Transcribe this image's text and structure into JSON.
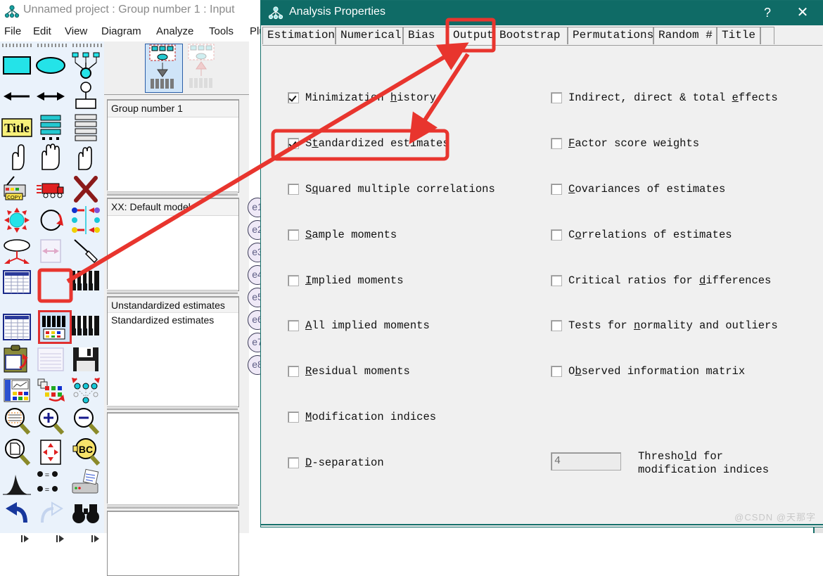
{
  "app": {
    "title": "Unnamed project : Group number 1 : Input",
    "icon": "amos-logo-icon",
    "menu": [
      "File",
      "Edit",
      "View",
      "Diagram",
      "Analyze",
      "Tools",
      "Plu"
    ]
  },
  "palette": {
    "name": "drawing-tools-palette",
    "selected_tool": "view-text-output-tool",
    "tools": [
      "draw-observed-variable",
      "draw-unobserved-variable",
      "draw-path-latent",
      "draw-path-arrow",
      "draw-covariance-arrow",
      "add-unique-variable",
      "figure-caption-title",
      "list-variables-in-dataset",
      "list-variables-in-model",
      "select-one-object",
      "select-all-objects",
      "deselect-all-objects",
      "duplicate-objects",
      "move-objects",
      "erase-objects",
      "shape-of-object",
      "rotate-indicators",
      "reflect-indicators",
      "move-parameter-values",
      "resize-diagram-to-page",
      "touch-up-variable",
      "select-data-file",
      "analysis-properties",
      "calculate-estimates",
      "clipboard-copy",
      "view-text-output",
      "save-diagram",
      "object-properties",
      "drag-properties",
      "preserve-symmetries",
      "zoom-select-area",
      "zoom-in",
      "zoom-out",
      "zoom-page",
      "fit-to-page",
      "loupe-magnify",
      "bayesian-estimation",
      "multiple-group-analysis",
      "print",
      "undo",
      "redo",
      "search-browse"
    ]
  },
  "mid_panel": {
    "tools": [
      "view-input-path-diagram",
      "view-output-path-diagram"
    ],
    "active_tool": "view-input-path-diagram",
    "groups": {
      "name": "groups-list",
      "items": [
        "Group number 1"
      ],
      "selected": "Group number 1"
    },
    "models": {
      "name": "models-list",
      "items": [
        "XX: Default model"
      ],
      "selected": "XX: Default model"
    },
    "estimates": {
      "name": "estimates-list",
      "items": [
        "Unstandardized estimates",
        "Standardized estimates"
      ],
      "selected": "Unstandardized estimates"
    }
  },
  "diagram": {
    "name": "path-diagram-canvas",
    "error_nodes": [
      "e1",
      "e2",
      "e3",
      "e4",
      "e5",
      "e6",
      "e7",
      "e8"
    ]
  },
  "dialog": {
    "title": "Analysis Properties",
    "icon": "amos-logo-icon",
    "help_label": "?",
    "close_label": "✕",
    "tabs": [
      {
        "label": "Estimation",
        "active": false
      },
      {
        "label": "Numerical",
        "active": false
      },
      {
        "label": "Bias",
        "active": false
      },
      {
        "label": "Output",
        "active": true
      },
      {
        "label": "Bootstrap",
        "active": false
      },
      {
        "label": "Permutations",
        "active": false
      },
      {
        "label": "Random #",
        "active": false
      },
      {
        "label": "Title",
        "active": false
      }
    ],
    "left_options": [
      {
        "label": "Minimization history",
        "accel": "h",
        "checked": true
      },
      {
        "label": "Standardized estimates",
        "accel": "t",
        "checked": true
      },
      {
        "label": "Squared multiple correlations",
        "accel": "q",
        "checked": false
      },
      {
        "label": "Sample moments",
        "accel": "S",
        "checked": false
      },
      {
        "label": "Implied moments",
        "accel": "I",
        "checked": false
      },
      {
        "label": "All implied moments",
        "accel": "A",
        "checked": false
      },
      {
        "label": "Residual moments",
        "accel": "R",
        "checked": false
      },
      {
        "label": "Modification indices",
        "accel": "M",
        "checked": false
      },
      {
        "label": "D-separation",
        "accel": "D",
        "checked": false
      }
    ],
    "right_options": [
      {
        "label": "Indirect, direct & total effects",
        "accel": "e",
        "checked": false
      },
      {
        "label": "Factor score weights",
        "accel": "F",
        "checked": false
      },
      {
        "label": "Covariances of estimates",
        "accel": "C",
        "checked": false
      },
      {
        "label": "Correlations of estimates",
        "accel": "o",
        "checked": false
      },
      {
        "label": "Critical ratios for differences",
        "accel": "d",
        "checked": false
      },
      {
        "label": "Tests for normality and outliers",
        "accel": "n",
        "checked": false
      },
      {
        "label": "Observed information matrix",
        "accel": "b",
        "checked": false
      }
    ],
    "threshold": {
      "value": "4",
      "label_line1": "Threshold for",
      "label_line2": "modification indices",
      "accel": "l"
    }
  },
  "annotations": {
    "highlight_color": "#e8352e",
    "boxes": [
      "output-tab-highlight",
      "standardized-estimates-highlight",
      "view-text-output-tool-highlight"
    ],
    "arrows": [
      "toolbar-to-output-tab-arrow",
      "output-tab-to-standardized-estimates-arrow"
    ]
  },
  "watermark": {
    "text": "@CSDN @天那字"
  }
}
